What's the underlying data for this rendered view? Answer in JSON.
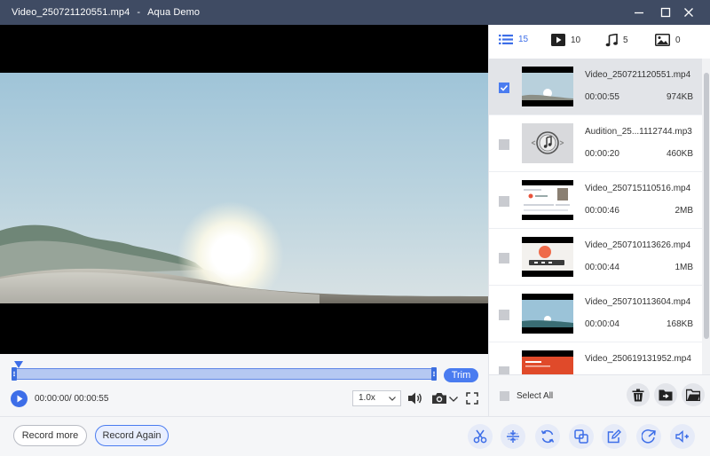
{
  "window": {
    "file_title": "Video_250721120551.mp4",
    "separator": "-",
    "app_name": "Aqua Demo"
  },
  "player": {
    "current_time": "00:00:00",
    "total_time": "00:00:55",
    "time_display": "00:00:00/ 00:00:55",
    "speed": "1.0x",
    "trim_label": "Trim"
  },
  "tabs": [
    {
      "icon": "list-icon",
      "count": "15"
    },
    {
      "icon": "video-icon",
      "count": "10"
    },
    {
      "icon": "music-icon",
      "count": "5"
    },
    {
      "icon": "image-icon",
      "count": "0"
    }
  ],
  "files": [
    {
      "name": "Video_250721120551.mp4",
      "duration": "00:00:55",
      "size": "974KB",
      "checked": true
    },
    {
      "name": "Audition_25...1112744.mp3",
      "duration": "00:00:20",
      "size": "460KB",
      "checked": false
    },
    {
      "name": "Video_250715110516.mp4",
      "duration": "00:00:46",
      "size": "2MB",
      "checked": false
    },
    {
      "name": "Video_250710113626.mp4",
      "duration": "00:00:44",
      "size": "1MB",
      "checked": false
    },
    {
      "name": "Video_250710113604.mp4",
      "duration": "00:00:04",
      "size": "168KB",
      "checked": false
    },
    {
      "name": "Video_250619131952.mp4",
      "duration": "",
      "size": "",
      "checked": false
    }
  ],
  "panel_footer": {
    "select_all": "Select All"
  },
  "bottom": {
    "record_more": "Record more",
    "record_again": "Record Again"
  },
  "colors": {
    "titlebar": "#3f4b63",
    "accent": "#3d6ee8",
    "trim": "#4a7cf0"
  }
}
